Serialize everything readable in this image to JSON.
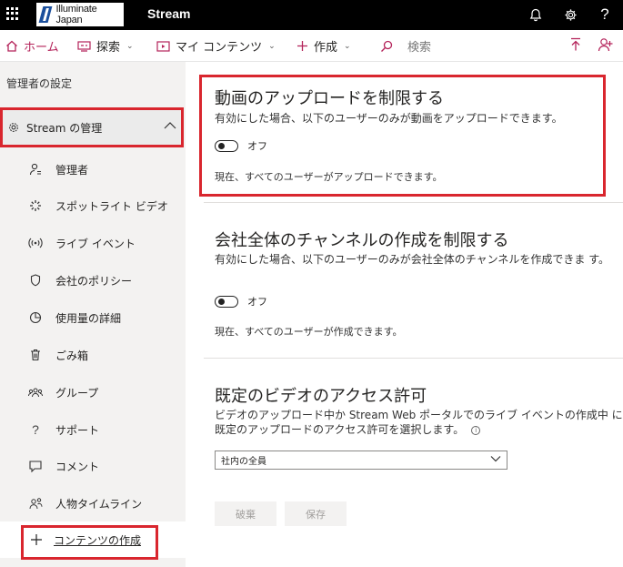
{
  "topbar": {
    "logo_text": "Illuminate Japan",
    "app_title": "Stream",
    "icons": [
      "waffle-icon",
      "bell-icon",
      "gear-icon",
      "help-icon"
    ],
    "help_glyph": "?"
  },
  "nav": {
    "home": "ホーム",
    "explore": "探索",
    "my_content": "マイ コンテンツ",
    "create": "作成",
    "search_placeholder": "検索"
  },
  "sidebar": {
    "heading": "管理者の設定",
    "group_label": "Stream の管理",
    "items": [
      {
        "label": "管理者",
        "icon": "admin-icon"
      },
      {
        "label": "スポットライト ビデオ",
        "icon": "spotlight-icon"
      },
      {
        "label": "ライブ イベント",
        "icon": "live-event-icon"
      },
      {
        "label": "会社のポリシー",
        "icon": "shield-icon"
      },
      {
        "label": "使用量の詳細",
        "icon": "pie-chart-icon"
      },
      {
        "label": "ごみ箱",
        "icon": "trash-icon"
      },
      {
        "label": "グループ",
        "icon": "group-icon"
      },
      {
        "label": "サポート",
        "icon": "question-icon"
      },
      {
        "label": "コメント",
        "icon": "comment-icon"
      },
      {
        "label": "人物タイムライン",
        "icon": "people-timeline-icon"
      }
    ],
    "create_content": "コンテンツの作成"
  },
  "main": {
    "upload": {
      "title": "動画のアップロードを制限する",
      "desc": "有効にした場合、以下のユーザーのみが動画をアップロードできます。",
      "toggle_label": "オフ",
      "status": "現在、すべてのユーザーがアップロードできます。"
    },
    "channel": {
      "title": "会社全体のチャンネルの作成を制限する",
      "desc": "有効にした場合、以下のユーザーのみが会社全体のチャンネルを作成できま す。",
      "toggle_label": "オフ",
      "status": "現在、すべてのユーザーが作成できます。"
    },
    "access": {
      "title": "既定のビデオのアクセス許可",
      "desc": "ビデオのアップロード中か Stream Web ポータルでのライブ イベントの作成中 に既定のアップロードのアクセス許可を選択します。",
      "select_value": "社内の全員"
    },
    "buttons": {
      "discard": "破棄",
      "save": "保存"
    }
  },
  "colors": {
    "accent": "#b4235a",
    "highlight": "#d9262e",
    "topbar": "#000000",
    "sidebar": "#f3f2f1"
  }
}
